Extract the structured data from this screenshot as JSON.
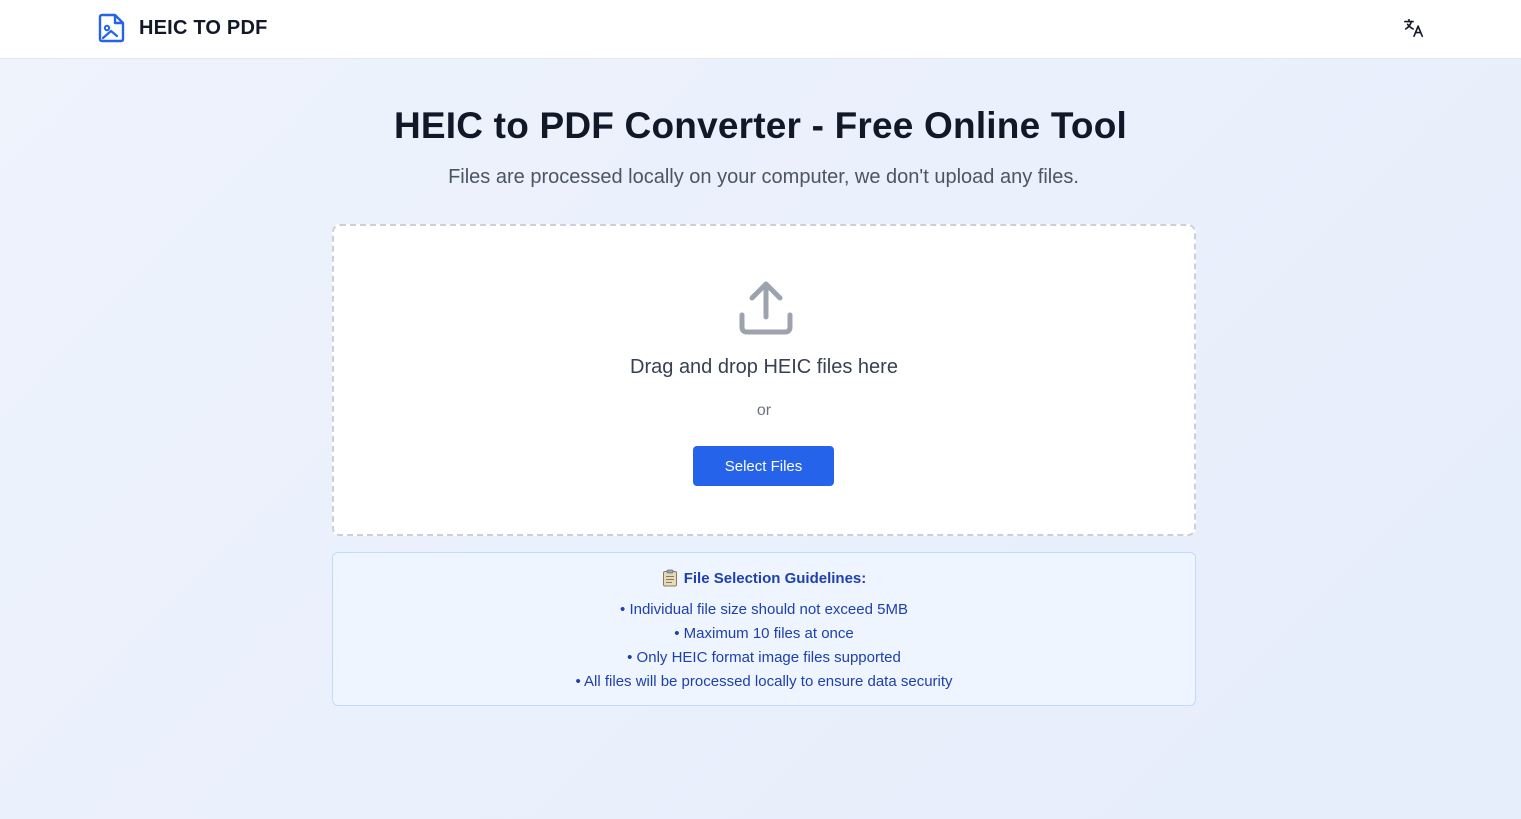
{
  "header": {
    "brand": "HEIC TO PDF",
    "logo_icon": "file-image-icon",
    "language_icon": "translate-icon"
  },
  "main": {
    "title": "HEIC to PDF Converter - Free Online Tool",
    "subtitle": "Files are processed locally on your computer, we don't upload any files."
  },
  "dropzone": {
    "icon": "upload-icon",
    "prompt": "Drag and drop HEIC files here",
    "or": "or",
    "button_label": "Select Files"
  },
  "guidelines": {
    "icon": "clipboard-icon",
    "title": "File Selection Guidelines:",
    "items": [
      "• Individual file size should not exceed 5MB",
      "• Maximum 10 files at once",
      "• Only HEIC format image files supported",
      "• All files will be processed locally to ensure data security"
    ]
  },
  "colors": {
    "accent": "#2563eb",
    "guideline_text": "#1e40af",
    "guideline_bg": "#eef5fe",
    "guideline_border": "#bfdbfe"
  }
}
